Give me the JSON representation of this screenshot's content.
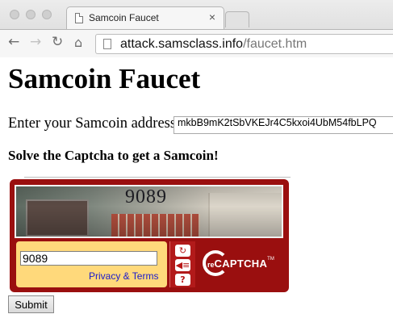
{
  "browser": {
    "tab_title": "Samcoin Faucet",
    "tab_close_glyph": "×",
    "url_host": "attack.samsclass.info",
    "url_path": "/faucet.htm",
    "nav_icons": [
      "back-arrow-icon",
      "forward-arrow-icon",
      "reload-icon",
      "home-icon"
    ]
  },
  "page": {
    "heading": "Samcoin Faucet",
    "address_label": "Enter your Samcoin address:",
    "address_value": "mkbB9mK2tSbVKEJr4C5kxoi4UbM54fbLPQ",
    "captcha_heading": "Solve the Captcha to get a Samcoin!",
    "submit_label": "Submit"
  },
  "captcha": {
    "challenge_text": "9089",
    "response_value": "9089",
    "privacy_link": "Privacy & Terms",
    "logo_re": "re",
    "logo_captcha": "CAPTCHA",
    "logo_tm": "TM",
    "controls": [
      "reload-icon",
      "audio-icon",
      "help-icon"
    ],
    "accent_color": "#9a0f0f",
    "panel_color": "#ffd97b"
  }
}
